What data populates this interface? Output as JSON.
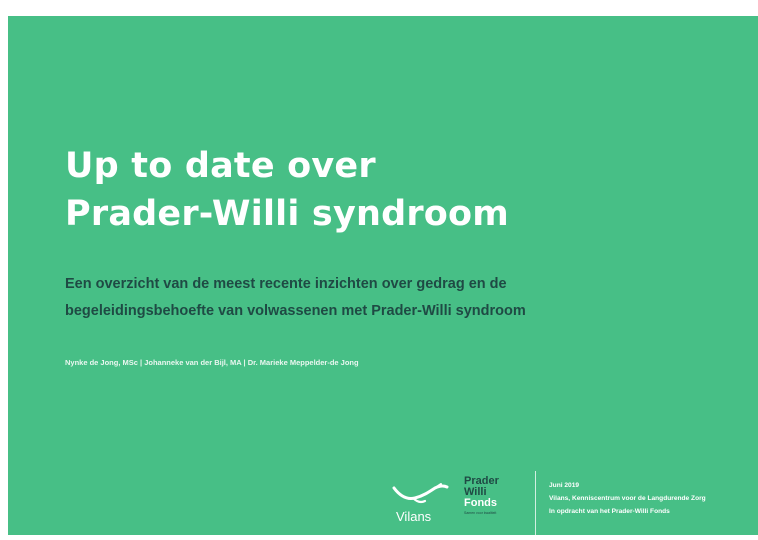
{
  "cover": {
    "title_lines": [
      "Up to date over",
      "Prader-Willi syndroom"
    ],
    "subtitle_lines": [
      "Een overzicht van de meest recente inzichten over gedrag en de",
      "begeleidingsbehoefte van volwassenen met Prader-Willi syndroom"
    ],
    "authors": "Nynke de Jong, MSc | Johanneke van der Bijl, MA | Dr. Marieke Meppelder-de Jong",
    "colors": {
      "background": "#47bf86",
      "title": "#ffffff",
      "subtitle": "#1f4a44"
    }
  },
  "footer": {
    "vilans_logo": {
      "name": "Vilans",
      "icon": "vilans-swoosh-icon"
    },
    "pw_logo": {
      "words": [
        "Prader",
        "Willi",
        "Fonds"
      ],
      "tagline": "Samen voor kwaliteit"
    },
    "meta_lines": [
      "Juni 2019",
      "Vilans, Kenniscentrum voor de Langdurende Zorg",
      "In opdracht van het Prader-Willi Fonds"
    ]
  }
}
